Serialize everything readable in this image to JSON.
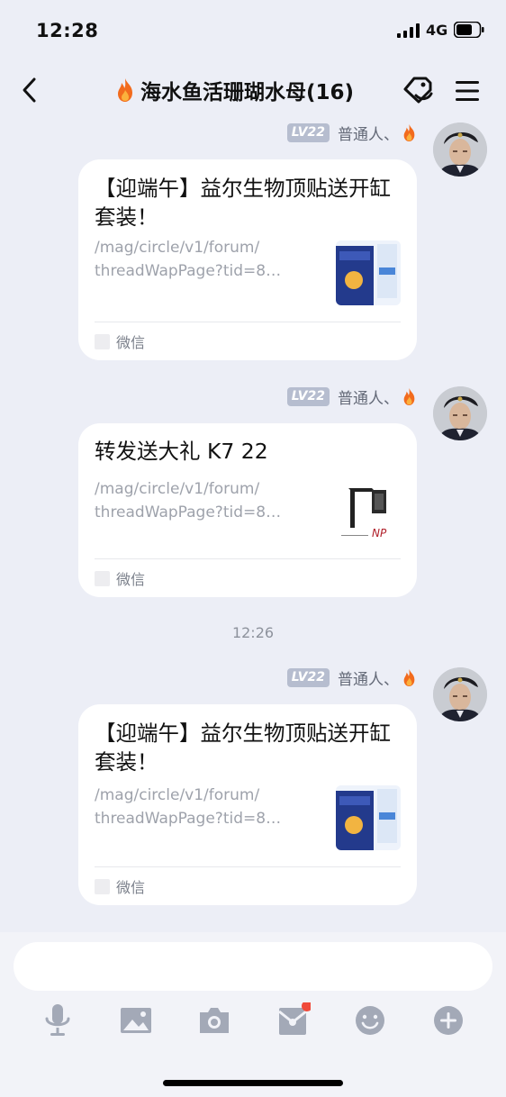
{
  "status_bar": {
    "time": "12:28",
    "network": "4G"
  },
  "nav": {
    "title": "海水鱼活珊瑚水母(16)"
  },
  "messages": [
    {
      "sender": {
        "level": "LV22",
        "name": "普通人、"
      },
      "card": {
        "title": "【迎端午】益尔生物顶贴送开缸套装！",
        "url": "/mag/circle/v1/forum/\nthreadWapPage?tid=8…",
        "source": "微信"
      }
    },
    {
      "sender": {
        "level": "LV22",
        "name": "普通人、"
      },
      "card": {
        "title": "转发送大礼 K7 22",
        "url": "/mag/circle/v1/forum/\nthreadWapPage?tid=8…",
        "source": "微信"
      }
    },
    {
      "sender": {
        "level": "LV22",
        "name": "普通人、"
      },
      "card": {
        "title": "【迎端午】益尔生物顶贴送开缸套装！",
        "url": "/mag/circle/v1/forum/\nthreadWapPage?tid=8…",
        "source": "微信"
      }
    }
  ],
  "time_divider": "12:26",
  "input": {
    "placeholder": ""
  },
  "colors": {
    "background": "#eceef6",
    "card": "#ffffff",
    "level_badge": "#b6bdcf",
    "notification_dot": "#f04a3a"
  },
  "icons": [
    "back-icon",
    "tag-link-icon",
    "menu-icon",
    "microphone-icon",
    "image-icon",
    "camera-icon",
    "red-packet-icon",
    "emoji-icon",
    "plus-icon"
  ]
}
